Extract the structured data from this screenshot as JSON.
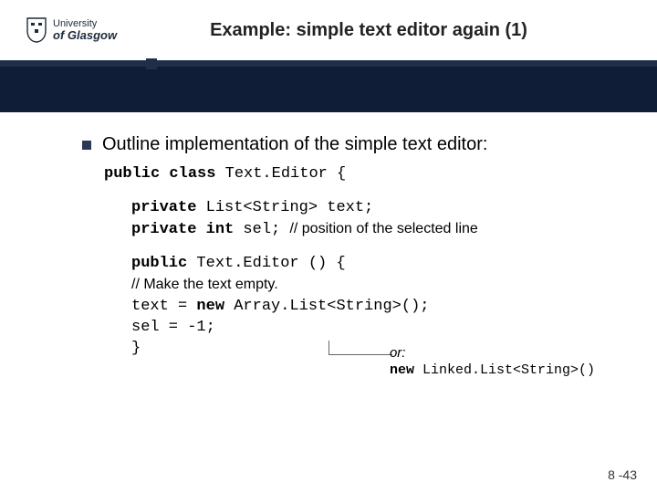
{
  "logo": {
    "line1": "University",
    "line2": "of Glasgow"
  },
  "title": "Example: simple text editor again (1)",
  "bullet": "Outline implementation of the simple text editor:",
  "code": {
    "l1a": "public class",
    "l1b": " Text.Editor {",
    "l2a": "private",
    "l2b": " List<String> text;",
    "l3a": "private int",
    "l3b": " sel;   ",
    "l3c": "// ",
    "l3d": "position of the selected line",
    "l4a": "public",
    "l4b": " Text.Editor () {",
    "l5": "// ",
    "l5b": "Make the text empty.",
    "l6a": "   text = ",
    "l6b": "new",
    "l6c": " Array.List<String>();",
    "l7": "   sel = -1;",
    "l8": "}"
  },
  "annotation": {
    "or": "or:",
    "alt_kw": "new",
    "alt_rest": " Linked.List<String>()"
  },
  "page": "8 -43"
}
